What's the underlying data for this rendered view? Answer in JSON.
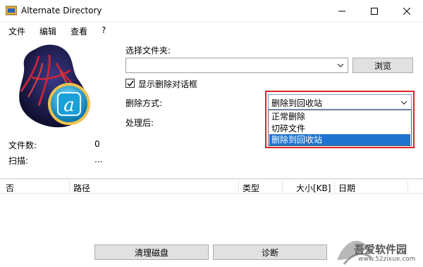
{
  "window": {
    "title": "Alternate Directory",
    "buttons": {
      "minimize": "minimize-icon",
      "maximize": "maximize-icon",
      "close": "close-icon"
    }
  },
  "menu": [
    "文件",
    "编辑",
    "查看",
    "?"
  ],
  "stats": {
    "files_label": "文件数:",
    "files_value": "0",
    "scan_label": "扫描:",
    "scan_value": "..."
  },
  "form": {
    "folder_label": "选择文件夹:",
    "folder_value": "",
    "browse_label": "浏览",
    "show_dialog_label": "显示删除对话框",
    "show_dialog_checked": true,
    "delete_method_label": "删除方式:",
    "after_label": "处理后:",
    "delete_method": {
      "selected": "删除到回收站",
      "options": [
        "正常删除",
        "切碎文件",
        "删除到回收站"
      ],
      "highlighted_index": 2
    }
  },
  "table": {
    "columns": [
      "否",
      "路径",
      "类型",
      "大小[KB]",
      "日期"
    ],
    "rows": []
  },
  "footer": {
    "clean_disk_label": "清理磁盘",
    "diagnose_label": "诊断"
  },
  "watermark": {
    "text": "吾爱软件园",
    "url": "www.52zixue.com"
  },
  "colors": {
    "highlight_border": "#d8232a",
    "selection": "#1e73cf",
    "button_face": "#e1e1e1"
  }
}
